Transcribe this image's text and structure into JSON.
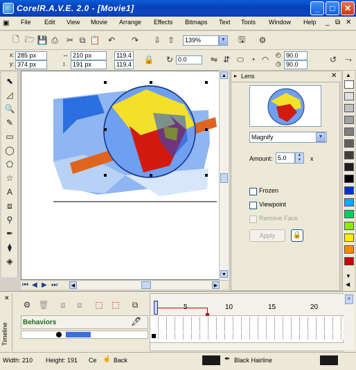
{
  "window": {
    "title": "CorelR.A.V.E. 2.0 - [Movie1]"
  },
  "menu": [
    "File",
    "Edit",
    "View",
    "Movie",
    "Arrange",
    "Effects",
    "Bitmaps",
    "Text",
    "Tools",
    "Window",
    "Help"
  ],
  "toolbar": {
    "zoom": "139%"
  },
  "propbar": {
    "x": "285 px",
    "y": "374 px",
    "w": "210 px",
    "h": "191 px",
    "scale_x": "119.4",
    "scale_y": "119.4",
    "rotation": "0.0",
    "angle1": "90.0",
    "angle2": "90.0"
  },
  "lens": {
    "tab": "Lens",
    "type": "Magnify",
    "amount_label": "Amount:",
    "amount": "5.0",
    "amount_unit": "x",
    "frozen": "Frozen",
    "viewpoint": "Viewpoint",
    "remove_face": "Remove Face",
    "apply": "Apply"
  },
  "timeline": {
    "side_label": "Timeline",
    "behaviors": "Behaviors",
    "ruler": [
      "5",
      "10",
      "15",
      "20"
    ]
  },
  "status": {
    "width": "Width: 210",
    "height": "Height: 191",
    "ce": "Ce",
    "mode": "Back",
    "fill_label": "Black Hairline"
  },
  "palette": [
    "#ffffff",
    "#e0e0e0",
    "#c0c0c0",
    "#a0a0a0",
    "#808080",
    "#606060",
    "#404040",
    "#202020",
    "#000000",
    "#0033cc",
    "#00aaff",
    "#00cc66",
    "#88ee00",
    "#ffee00",
    "#ff8800",
    "#cc0000"
  ],
  "colors": {
    "accent": "#0a47c2",
    "artwork_blue": "#6f9ff0",
    "artwork_yellow": "#f2e02a",
    "artwork_red": "#d21a0f",
    "artwork_orange": "#e0641e"
  }
}
